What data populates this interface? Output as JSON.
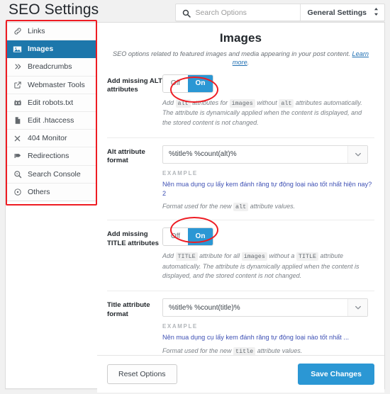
{
  "header": {
    "title": "SEO Settings",
    "search": {
      "placeholder": "Search Options",
      "value": "",
      "icon": "search-icon"
    },
    "settings_dropdown": {
      "label": "General Settings",
      "icon": "up-down-arrow-icon"
    }
  },
  "sidebar": {
    "items": [
      {
        "label": "Links",
        "icon": "link-icon",
        "active": false
      },
      {
        "label": "Images",
        "icon": "image-icon",
        "active": true
      },
      {
        "label": "Breadcrumbs",
        "icon": "chevron-double-right-icon",
        "active": false
      },
      {
        "label": "Webmaster Tools",
        "icon": "external-link-icon",
        "active": false
      },
      {
        "label": "Edit robots.txt",
        "icon": "robot-icon",
        "active": false
      },
      {
        "label": "Edit .htaccess",
        "icon": "file-icon",
        "active": false
      },
      {
        "label": "404 Monitor",
        "icon": "close-x-icon",
        "active": false
      },
      {
        "label": "Redirections",
        "icon": "flag-arrow-icon",
        "active": false
      },
      {
        "label": "Search Console",
        "icon": "magnifier-icon",
        "active": false
      },
      {
        "label": "Others",
        "icon": "circle-dot-icon",
        "active": false
      }
    ]
  },
  "main": {
    "section_title": "Images",
    "section_sub_text": "SEO options related to featured images and media appearing in your post content. ",
    "section_sub_link": "Learn more",
    "section_sub_end": ".",
    "rows": {
      "alt_toggle": {
        "label": "Add missing ALT attributes",
        "off_label": "Off",
        "on_label": "On",
        "state": "On",
        "help_parts": [
          {
            "t": "Add ",
            "code": false
          },
          {
            "t": "alt",
            "code": true
          },
          {
            "t": " attributes for ",
            "code": false
          },
          {
            "t": "images",
            "code": true
          },
          {
            "t": " without ",
            "code": false
          },
          {
            "t": "alt",
            "code": true
          },
          {
            "t": " attributes automatically. The attribute is dynamically applied when the content is displayed, and the stored content is not changed.",
            "code": false
          }
        ]
      },
      "alt_format": {
        "label": "Alt attribute format",
        "value": "%title% %count(alt)%",
        "caret_icon": "chevron-down-icon",
        "example_label": "EXAMPLE",
        "example_text": "Nên mua dụng cụ lấy kem đánh răng tự động loại nào tốt nhất hiện nay? 2",
        "note_parts": [
          {
            "t": "Format used for the new ",
            "code": false
          },
          {
            "t": "alt",
            "code": true
          },
          {
            "t": " attribute values.",
            "code": false
          }
        ]
      },
      "title_toggle": {
        "label": "Add missing TITLE attributes",
        "off_label": "Off",
        "on_label": "On",
        "state": "On",
        "help_parts": [
          {
            "t": "Add ",
            "code": false
          },
          {
            "t": "TITLE",
            "code": true
          },
          {
            "t": " attribute for all ",
            "code": false
          },
          {
            "t": "images",
            "code": true
          },
          {
            "t": " without a ",
            "code": false
          },
          {
            "t": "TITLE",
            "code": true
          },
          {
            "t": " attribute automatically. The attribute is dynamically applied when the content is displayed, and the stored content is not changed.",
            "code": false
          }
        ]
      },
      "title_format": {
        "label": "Title attribute format",
        "value": "%title% %count(title)%",
        "caret_icon": "chevron-down-icon",
        "example_label": "EXAMPLE",
        "example_text": "Nên mua dụng cụ lấy kem đánh răng tự động loại nào tốt nhất ...",
        "note_parts": [
          {
            "t": "Format used for the new ",
            "code": false
          },
          {
            "t": "title",
            "code": true
          },
          {
            "t": " attribute values.",
            "code": false
          }
        ]
      }
    }
  },
  "footer": {
    "reset_label": "Reset Options",
    "save_label": "Save Changes"
  },
  "annotations": {
    "color": "#ee1c23",
    "sidebar_rect": true,
    "toggle_ellipses": 2
  },
  "colors": {
    "accent_blue": "#2b97d4",
    "active_nav_blue": "#1d77ab",
    "annotation_red": "#ee1c23",
    "example_text": "#3f51b5",
    "page_bg": "#f1f1f1"
  }
}
